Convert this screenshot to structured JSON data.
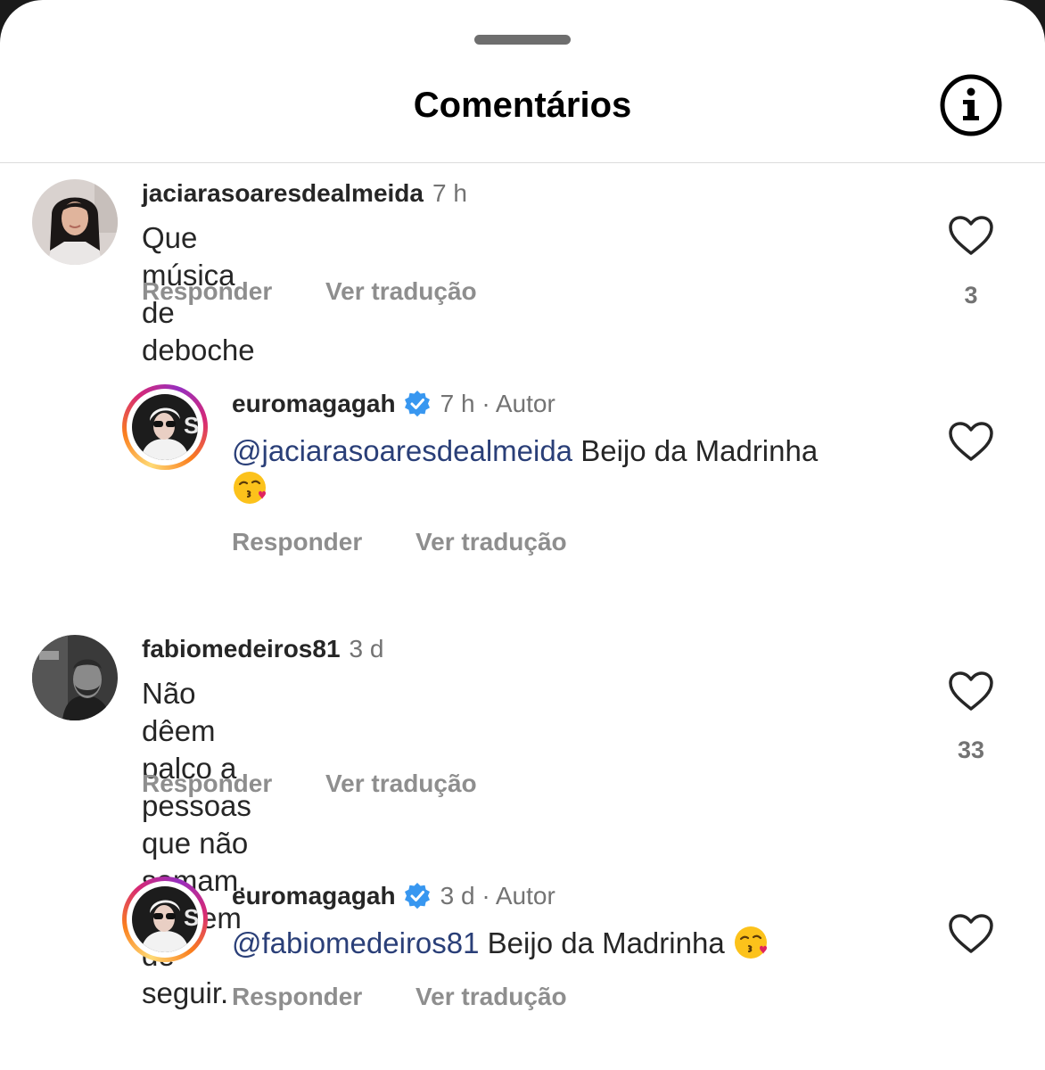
{
  "header": {
    "title": "Comentários",
    "info_icon": "info-icon"
  },
  "actions": {
    "reply": "Responder",
    "translate": "Ver tradução"
  },
  "comments": [
    {
      "username": "jaciarasoaresdealmeida",
      "time": "7 h",
      "text": "Que música de deboche",
      "likes": "3",
      "avatar_icon": "avatar-woman-photo"
    },
    {
      "username": "euromagagah",
      "verified": true,
      "time": "7 h · Autor",
      "mention": "@jaciarasoaresdealmeida",
      "text": " Beijo da Madrinha",
      "emoji": "kissing-face-emoji",
      "avatar_icon": "avatar-story-ring"
    },
    {
      "username": "fabiomedeiros81",
      "time": "3 d",
      "text_line1": "Não dêem palco a pessoas que não somam.",
      "text_line2": "Deixem de seguir.",
      "likes": "33",
      "avatar_icon": "avatar-man-photo"
    },
    {
      "username": "euromagagah",
      "verified": true,
      "time": "3 d · Autor",
      "mention": "@fabiomedeiros81",
      "text": " Beijo da Madrinha ",
      "emoji": "kissing-face-emoji",
      "avatar_icon": "avatar-story-ring"
    }
  ],
  "colors": {
    "mention": "#2a3f78",
    "verified": "#3897f0",
    "muted": "#8e8e8e"
  }
}
